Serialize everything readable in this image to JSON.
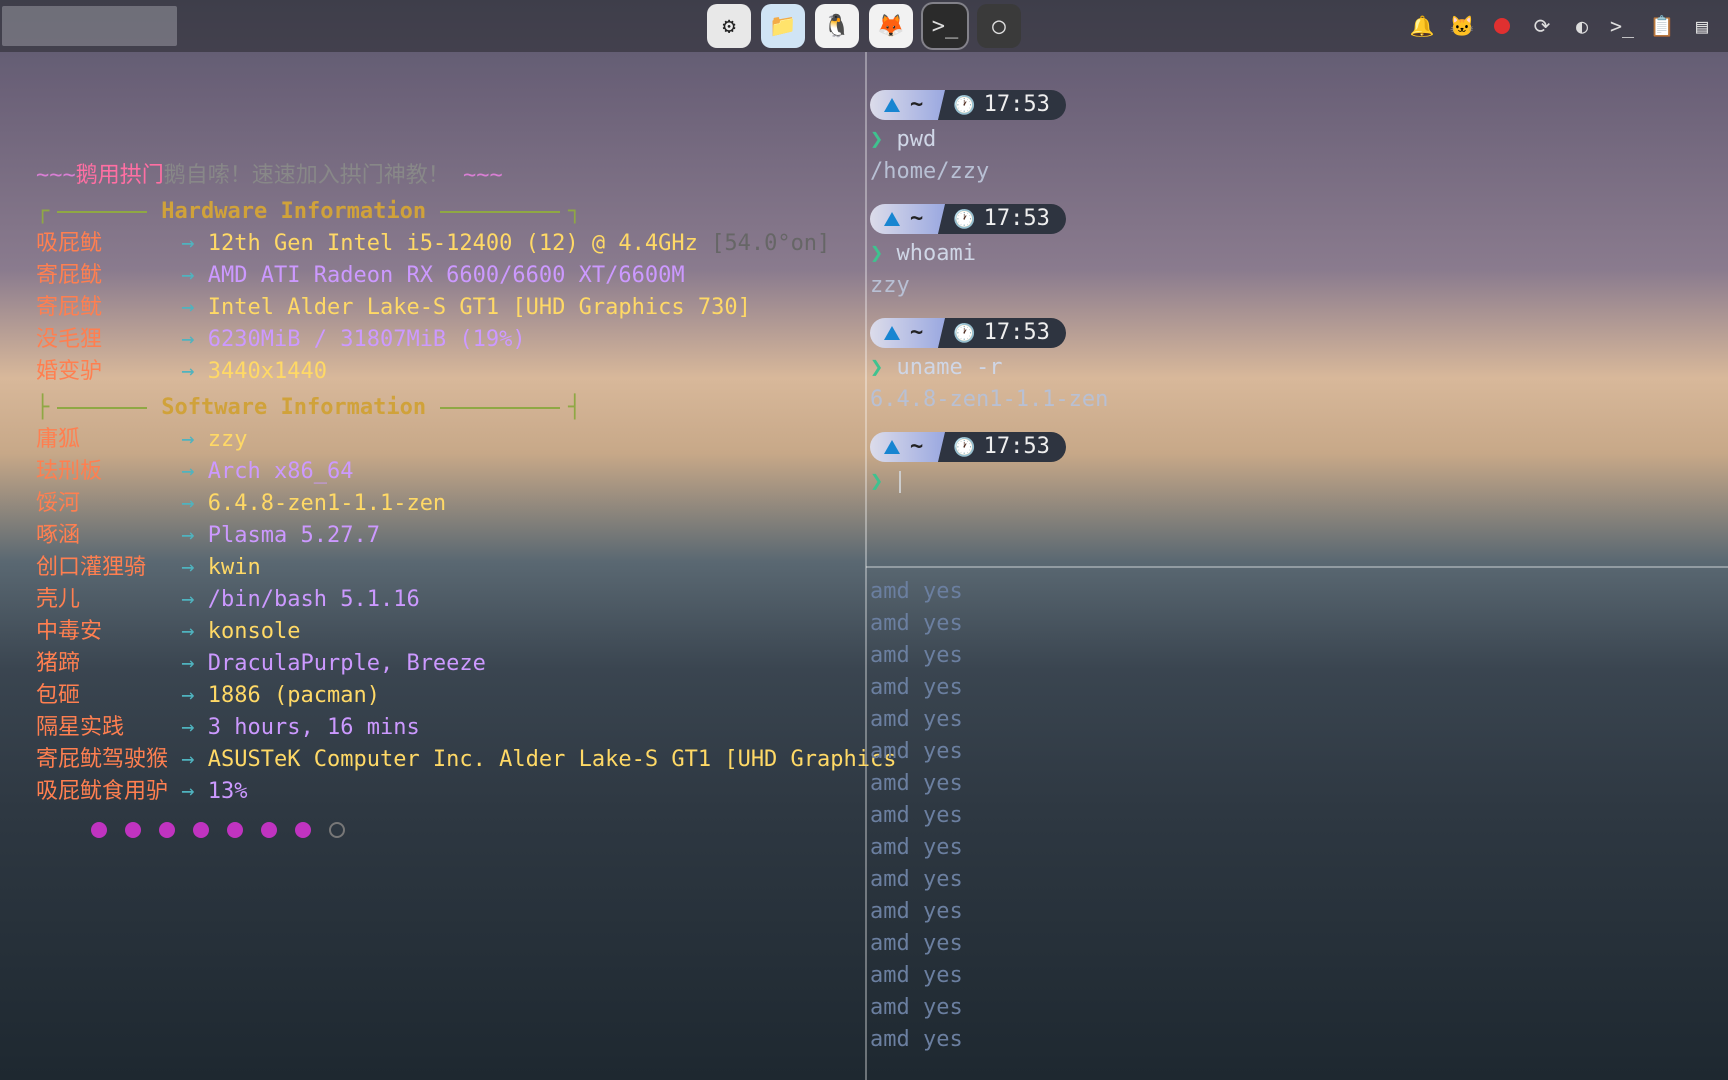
{
  "taskbar": {
    "dock": [
      {
        "name": "settings-icon",
        "bg": "#e8e8e8",
        "glyph": "⚙"
      },
      {
        "name": "files-icon",
        "bg": "#d0e4f5",
        "glyph": "📁"
      },
      {
        "name": "qq-icon",
        "bg": "#f2f2f2",
        "glyph": "🐧"
      },
      {
        "name": "firefox-icon",
        "bg": "#f2f2f2",
        "glyph": "🦊"
      },
      {
        "name": "terminal-icon",
        "bg": "#2b2b2b",
        "glyph": ">_",
        "active": true
      },
      {
        "name": "obs-icon",
        "bg": "#3a3a3a",
        "glyph": "◯"
      }
    ],
    "tray": [
      {
        "name": "bell-icon",
        "glyph": "🔔"
      },
      {
        "name": "cat-icon",
        "glyph": "🐱"
      },
      {
        "name": "record-icon",
        "glyph": "rec"
      },
      {
        "name": "sync-icon",
        "glyph": "⟳"
      },
      {
        "name": "steam-icon",
        "glyph": "◐"
      },
      {
        "name": "konsole-tray-icon",
        "glyph": ">_"
      },
      {
        "name": "clipboard-icon",
        "glyph": "📋"
      },
      {
        "name": "panel-icon",
        "glyph": "▤"
      }
    ]
  },
  "tagline": {
    "pre": "~~~",
    "a": "鹅用拱门",
    "b": "鹅自嗦！速速加入拱门神教！",
    "post": " ~~~"
  },
  "hw_title": "Hardware Information",
  "sw_title": "Software Information",
  "hw": [
    {
      "label": "吸屁鱿",
      "value": "12th Gen Intel i5-12400 (12) @ 4.4GHz",
      "extra": "[54.0°on]"
    },
    {
      "label": "寄屁鱿",
      "value": "AMD ATI Radeon RX 6600/6600 XT/6600M",
      "extra": ""
    },
    {
      "label": "寄屁鱿",
      "value": "Intel Alder Lake-S GT1 [UHD Graphics 730]",
      "extra": ""
    },
    {
      "label": "没毛狸",
      "value": "6230MiB / 31807MiB (19%)",
      "extra": ""
    },
    {
      "label": "婚变驴",
      "value": "3440x1440",
      "extra": ""
    }
  ],
  "sw": [
    {
      "label": "庸狐",
      "value": "zzy"
    },
    {
      "label": "珐刑板",
      "value": "Arch x86_64"
    },
    {
      "label": "馁河",
      "value": "6.4.8-zen1-1.1-zen"
    },
    {
      "label": "啄涵",
      "value": "Plasma 5.27.7"
    },
    {
      "label": "创口灌狸骑",
      "value": "kwin"
    },
    {
      "label": "壳儿",
      "value": "/bin/bash 5.1.16"
    },
    {
      "label": "中毒安",
      "value": "konsole"
    },
    {
      "label": "猪蹄",
      "value": "DraculaPurple, Breeze"
    },
    {
      "label": "包砸",
      "value": "1886 (pacman)"
    },
    {
      "label": "隔星实践",
      "value": "3 hours, 16 mins"
    },
    {
      "label": "寄屁鱿驾驶猴",
      "value": "ASUSTeK Computer Inc. Alder Lake-S GT1 [UHD Graphics"
    },
    {
      "label": "吸屁鱿食用驴",
      "value": "13%"
    }
  ],
  "arrow": "→",
  "shell": {
    "cwd": "~",
    "time": "17:53",
    "blocks": [
      {
        "cmd": "pwd",
        "out": "/home/zzy"
      },
      {
        "cmd": "whoami",
        "out": "zzy"
      },
      {
        "cmd": "uname -r",
        "out": "6.4.8-zen1-1.1-zen"
      }
    ],
    "prompt_glyph": "❯"
  },
  "loop_line": "amd yes",
  "loop_count": 15
}
